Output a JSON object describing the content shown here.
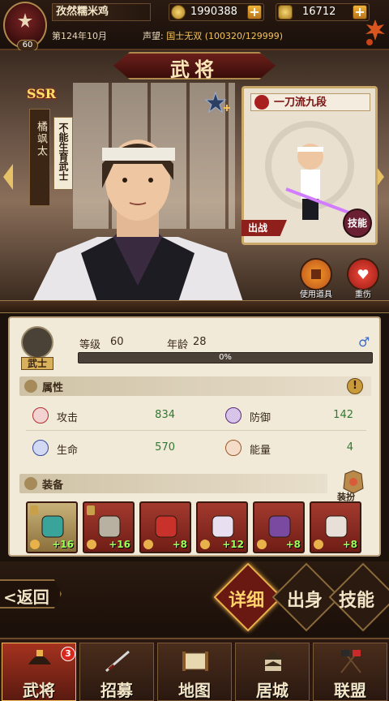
{
  "player": {
    "level": "60",
    "name": "孜然糯米鸡",
    "date": "第124年10月",
    "prestige_label": "声望:",
    "prestige_value": "国士无双 (100320/129999)"
  },
  "resources": {
    "gold": "1990388",
    "koban": "16712"
  },
  "page_title": "武将",
  "hero": {
    "rarity": "SSR",
    "name": "橘飒太",
    "trait": "不能生育武士",
    "skill_name": "一刀流九段",
    "deploy_label": "出战",
    "skill_seal": "技能",
    "use_item_label": "使用道具",
    "heal_label": "重伤"
  },
  "stats": {
    "class_label": "武士",
    "level_label": "等级",
    "level_value": "60",
    "age_label": "年龄",
    "age_value": "28",
    "gender": "♂",
    "xp_percent": 0,
    "xp_text": "0%",
    "attr_header": "属性",
    "warn_mark": "!",
    "attack_label": "攻击",
    "attack_value": "834",
    "defense_label": "防御",
    "defense_value": "142",
    "hp_label": "生命",
    "hp_value": "570",
    "energy_label": "能量",
    "energy_value": "4",
    "equip_header": "装备",
    "dress_label": "装扮"
  },
  "equipment": [
    {
      "bonus": "+16",
      "locked": true
    },
    {
      "bonus": "+16",
      "locked": true
    },
    {
      "bonus": "+8",
      "locked": false
    },
    {
      "bonus": "+12",
      "locked": false
    },
    {
      "bonus": "+8",
      "locked": false
    },
    {
      "bonus": "+8",
      "locked": false
    }
  ],
  "actions": {
    "back": "<返回",
    "detail": "详细",
    "origin": "出身",
    "skill": "技能"
  },
  "nav": {
    "generals": "武将",
    "generals_badge": "3",
    "recruit": "招募",
    "map": "地图",
    "castle": "居城",
    "alliance": "联盟"
  },
  "icons": {
    "gold": "gold-coin-icon",
    "koban": "koban-icon",
    "star": "star-plus-icon",
    "gender": "male-icon"
  },
  "colors": {
    "accent_red": "#6a1812",
    "gold": "#e9b14a",
    "stat_green": "#2f7a30",
    "bonus_green": "#9cff5a"
  }
}
